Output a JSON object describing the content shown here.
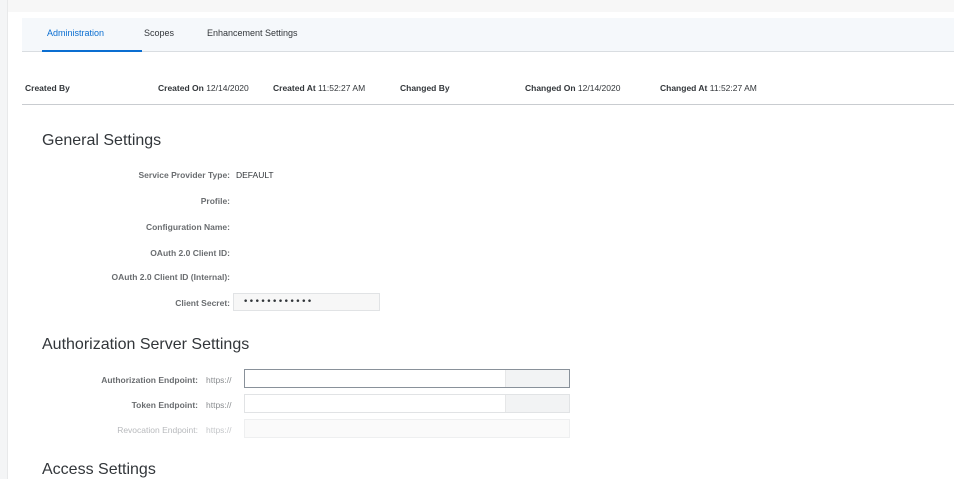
{
  "tabs": [
    {
      "label": "Administration",
      "active": true
    },
    {
      "label": "Scopes",
      "active": false
    },
    {
      "label": "Enhancement Settings",
      "active": false
    }
  ],
  "meta": {
    "created_by_label": "Created By",
    "created_on_label": "Created On",
    "created_on_value": "12/14/2020",
    "created_at_label": "Created At",
    "created_at_value": "11:52:27 AM",
    "changed_by_label": "Changed By",
    "changed_on_label": "Changed On",
    "changed_on_value": "12/14/2020",
    "changed_at_label": "Changed At",
    "changed_at_value": "11:52:27 AM"
  },
  "general": {
    "title": "General Settings",
    "service_provider_type_label": "Service Provider Type:",
    "service_provider_type_value": "DEFAULT",
    "profile_label": "Profile:",
    "configuration_name_label": "Configuration Name:",
    "client_id_label": "OAuth 2.0 Client ID:",
    "client_id_internal_label": "OAuth 2.0 Client ID (Internal):",
    "client_secret_label": "Client Secret:",
    "client_secret_value": "••••••••••••"
  },
  "auth_server": {
    "title": "Authorization Server Settings",
    "authorization_endpoint_label": "Authorization Endpoint:",
    "token_endpoint_label": "Token Endpoint:",
    "revocation_endpoint_label": "Revocation Endpoint:",
    "url_prefix": "https://"
  },
  "access": {
    "title": "Access Settings"
  }
}
